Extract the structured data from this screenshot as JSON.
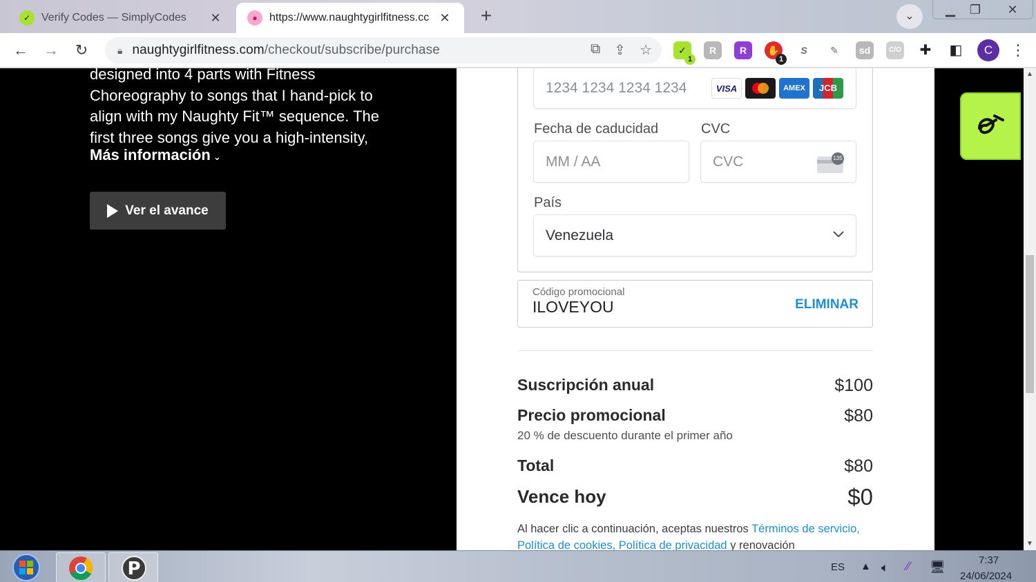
{
  "browser": {
    "tabs": [
      {
        "title": "Verify Codes — SimplyCodes",
        "active": false,
        "favicon": "simplycodes-icon"
      },
      {
        "title": "https://www.naughtygirlfitness.cc",
        "active": true,
        "favicon": "lips-icon"
      }
    ],
    "new_tab_label": "+",
    "address": {
      "domain": "naughtygirlfitness.com",
      "path": "/checkout/subscribe/purchase"
    },
    "profile_initial": "C",
    "extension_badges": {
      "simplycodes": "1",
      "adblock": "1"
    }
  },
  "left": {
    "description": "designed into 4 parts with Fitness Choreography to songs that I hand-pick to align with my Naughty Fit™ sequence. The first three songs give you a high-intensity,",
    "more_info": "Más información",
    "trailer_button": "Ver el avance"
  },
  "payment": {
    "card_number_placeholder": "1234 1234 1234 1234",
    "card_brands": [
      "VISA",
      "Mastercard",
      "AMEX",
      "JCB"
    ],
    "expiry_label": "Fecha de caducidad",
    "expiry_placeholder": "MM / AA",
    "cvc_label": "CVC",
    "cvc_placeholder": "CVC",
    "cvc_badge": "135",
    "country_label": "País",
    "country_value": "Venezuela"
  },
  "promo": {
    "label": "Código promocional",
    "code": "ILOVEYOU",
    "remove_label": "ELIMINAR"
  },
  "summary": {
    "annual_label": "Suscripción anual",
    "annual_amount": "$100",
    "promo_label": "Precio promocional",
    "promo_amount": "$80",
    "promo_note": "20 % de descuento durante el primer año",
    "total_label": "Total",
    "total_amount": "$80",
    "due_label": "Vence hoy",
    "due_amount": "$0"
  },
  "terms": {
    "prefix": "Al hacer clic a continuación, aceptas nuestros",
    "tos": "Términos de servicio,",
    "cookies": "Política de cookies,",
    "privacy": "Política de privacidad",
    "suffix": "y renovación"
  },
  "taskbar": {
    "language": "ES",
    "time": "7:37",
    "date": "24/06/2024"
  },
  "colors": {
    "accent_link": "#1b8fd6",
    "chat_widget": "#b5f24a",
    "page_dark": "#000000"
  }
}
